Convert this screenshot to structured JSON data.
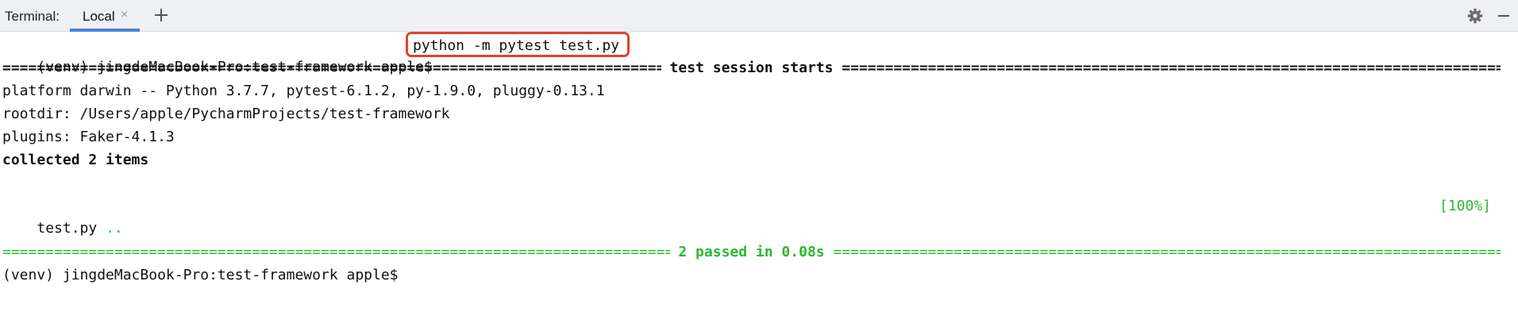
{
  "tabbar": {
    "label": "Terminal:",
    "tab": "Local",
    "close_glyph": "×",
    "add_icon": "plus-icon",
    "settings_icon": "gear-icon",
    "hide_icon": "minimize-icon"
  },
  "terminal": {
    "prompt_1": "(venv) jingdeMacBook-Pro:test-framework apple$",
    "command": "python -m pytest test.py",
    "session_start_label": " test session starts ",
    "platform": "platform darwin -- Python 3.7.7, pytest-6.1.2, py-1.9.0, pluggy-0.13.1",
    "rootdir": "rootdir: /Users/apple/PycharmProjects/test-framework",
    "plugins": "plugins: Faker-4.1.3",
    "collected": "collected 2 items",
    "test_file": "test.py",
    "test_dots": "..",
    "test_percent": "[100%]",
    "summary_label": " 2 passed in 0.08s ",
    "prompt_2": "(venv) jingdeMacBook-Pro:test-framework apple$"
  },
  "colors": {
    "pass_green": "#2db82d",
    "highlight_red": "#e0432c",
    "tab_underline": "#4a82d6"
  }
}
